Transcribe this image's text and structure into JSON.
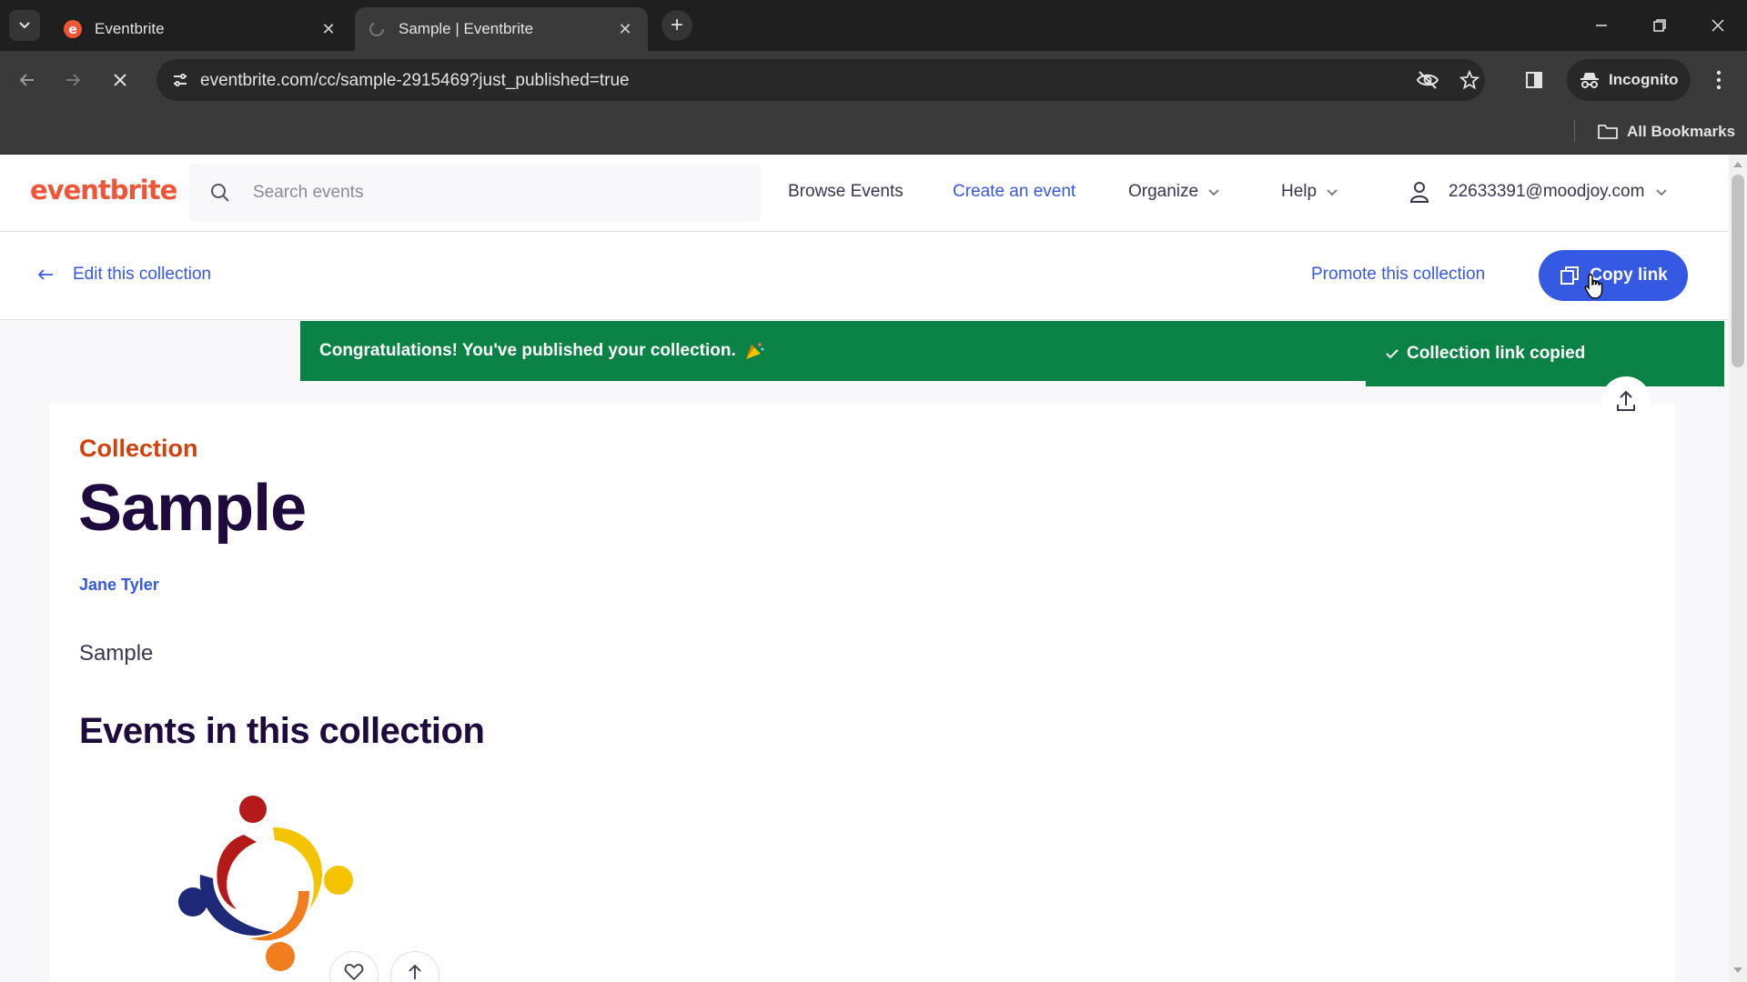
{
  "browser": {
    "tabs": [
      {
        "title": "Eventbrite",
        "active": false
      },
      {
        "title": "Sample | Eventbrite",
        "active": true
      }
    ],
    "url": "eventbrite.com/cc/sample-2915469?just_published=true",
    "incognito_label": "Incognito",
    "bookmarks_label": "All Bookmarks"
  },
  "header": {
    "logo": "eventbrite",
    "search_placeholder": "Search events",
    "nav": {
      "browse": "Browse Events",
      "create": "Create an event",
      "organize": "Organize",
      "help": "Help"
    },
    "user_email": "22633391@moodjoy.com"
  },
  "subbar": {
    "edit_label": "Edit this collection",
    "promote_label": "Promote this collection",
    "copy_label": "Copy link"
  },
  "banner": {
    "message": "Congratulations! You've published your collection."
  },
  "toast": {
    "message": "Collection link copied"
  },
  "collection": {
    "eyebrow": "Collection",
    "title": "Sample",
    "organizer": "Jane Tyler",
    "description": "Sample",
    "events_heading": "Events in this collection"
  },
  "colors": {
    "brand_orange": "#f05537",
    "link_blue": "#3659e3",
    "success_green": "#0b8245",
    "title_navy": "#1e0a3c",
    "eyebrow_orange": "#d1410c"
  }
}
